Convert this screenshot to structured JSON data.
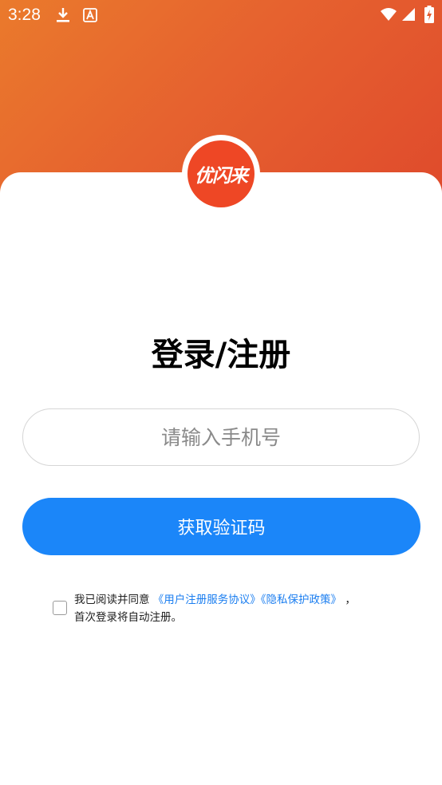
{
  "status_bar": {
    "time": "3:28",
    "icons": [
      "download-icon",
      "font-a-icon",
      "wifi-icon",
      "signal-icon",
      "battery-charging-icon"
    ]
  },
  "logo": {
    "text": "优闪来"
  },
  "page_title": "登录/注册",
  "phone_input": {
    "placeholder": "请输入手机号",
    "value": ""
  },
  "get_code_button": "获取验证码",
  "agreement": {
    "checked": false,
    "prefix": "我已阅读并同意",
    "user_agreement": "《用户注册服务协议》",
    "privacy_policy": "《隐私保护政策》",
    "suffix": "，",
    "second_line": "首次登录将自动注册。"
  },
  "colors": {
    "hero_gradient_start": "#ea7a2c",
    "hero_gradient_end": "#df4a2c",
    "logo_red": "#ee4725",
    "primary_blue": "#1b86f9",
    "link_blue": "#1b7ef0"
  }
}
